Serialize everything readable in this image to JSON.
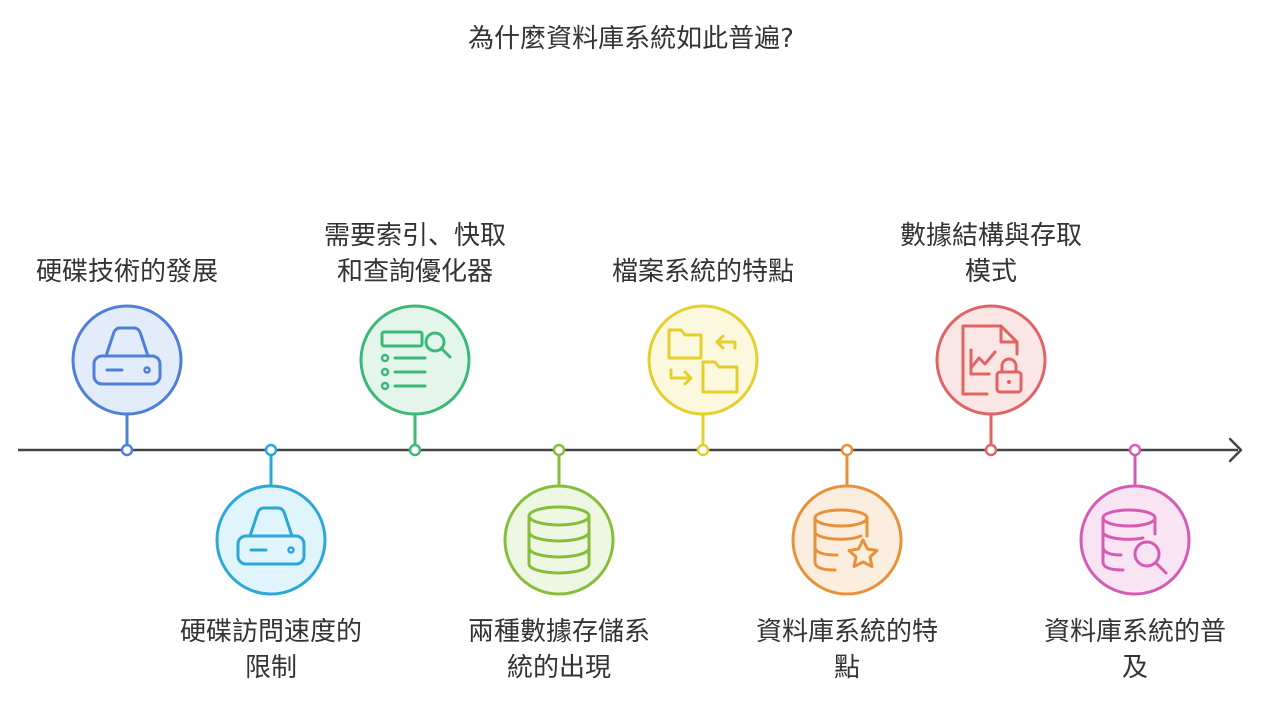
{
  "title": "為什麼資料庫系統如此普遍?",
  "timeline": {
    "line_color": "#444444",
    "events": [
      {
        "label_lines": [
          "硬碟技術的發展"
        ],
        "position": "above",
        "icon": "hard-drive-icon",
        "color": "#4F7FD8",
        "fill": "#E3ECFA"
      },
      {
        "label_lines": [
          "硬碟訪問速度的",
          "限制"
        ],
        "position": "below",
        "icon": "hard-drive-icon",
        "color": "#2BA8D8",
        "fill": "#E0F4FB"
      },
      {
        "label_lines": [
          "需要索引、快取",
          "和查詢優化器"
        ],
        "position": "above",
        "icon": "list-search-icon",
        "color": "#3CB878",
        "fill": "#E4F6EC"
      },
      {
        "label_lines": [
          "兩種數據存儲系",
          "統的出現"
        ],
        "position": "below",
        "icon": "database-icon",
        "color": "#86BE3C",
        "fill": "#EEF7E2"
      },
      {
        "label_lines": [
          "檔案系統的特點"
        ],
        "position": "above",
        "icon": "folders-swap-icon",
        "color": "#E4CF2C",
        "fill": "#FBF8DE"
      },
      {
        "label_lines": [
          "資料庫系統的特",
          "點"
        ],
        "position": "below",
        "icon": "database-star-icon",
        "color": "#E8913A",
        "fill": "#FCEEDF"
      },
      {
        "label_lines": [
          "數據結構與存取",
          "模式"
        ],
        "position": "above",
        "icon": "file-chart-lock-icon",
        "color": "#E06464",
        "fill": "#FBE6E6"
      },
      {
        "label_lines": [
          "資料庫系統的普",
          "及"
        ],
        "position": "below",
        "icon": "database-search-icon",
        "color": "#D65BB4",
        "fill": "#F9E4F3"
      }
    ]
  }
}
